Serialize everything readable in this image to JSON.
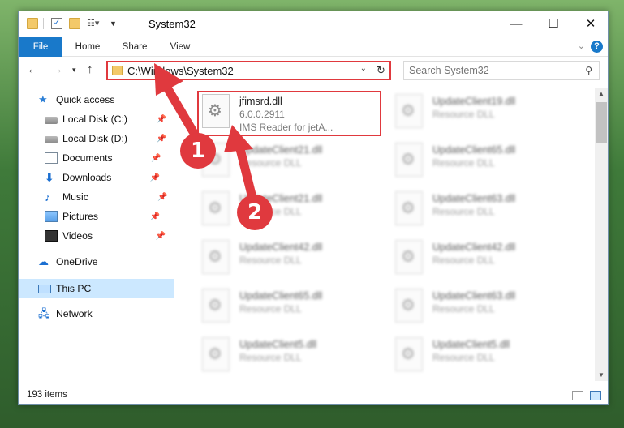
{
  "window": {
    "title": "System32",
    "controls": {
      "minimize": "—",
      "maximize": "☐",
      "close": "✕"
    }
  },
  "ribbon": {
    "tabs": [
      "File",
      "Home",
      "Share",
      "View"
    ],
    "help": "?"
  },
  "address": {
    "path": "C:\\Windows\\System32",
    "search_placeholder": "Search System32"
  },
  "nav_pane": {
    "quick_access": "Quick access",
    "items": [
      {
        "label": "Local Disk (C:)",
        "icon": "drive-icon"
      },
      {
        "label": "Local Disk (D:)",
        "icon": "drive-icon"
      },
      {
        "label": "Documents",
        "icon": "documents-icon"
      },
      {
        "label": "Downloads",
        "icon": "downloads-icon"
      },
      {
        "label": "Music",
        "icon": "music-icon"
      },
      {
        "label": "Pictures",
        "icon": "pictures-icon"
      },
      {
        "label": "Videos",
        "icon": "videos-icon"
      }
    ],
    "onedrive": "OneDrive",
    "this_pc": "This PC",
    "network": "Network"
  },
  "files": {
    "highlighted": {
      "name": "jfimsrd.dll",
      "version": "6.0.0.2911",
      "description": "IMS Reader for jetA..."
    },
    "left_column": [
      {
        "name": "UpdateClient21.dll",
        "description": "Resource DLL"
      },
      {
        "name": "UpdateClient21.dll",
        "description": "Resource DLL"
      },
      {
        "name": "UpdateClient42.dll",
        "description": "Resource DLL"
      },
      {
        "name": "UpdateClient65.dll",
        "description": "Resource DLL"
      },
      {
        "name": "UpdateClient5.dll",
        "description": "Resource DLL"
      }
    ],
    "right_column": [
      {
        "name": "UpdateClient19.dll",
        "description": "Resource DLL"
      },
      {
        "name": "UpdateClient65.dll",
        "description": "Resource DLL"
      },
      {
        "name": "UpdateClient63.dll",
        "description": "Resource DLL"
      },
      {
        "name": "UpdateClient42.dll",
        "description": "Resource DLL"
      },
      {
        "name": "UpdateClient63.dll",
        "description": "Resource DLL"
      },
      {
        "name": "UpdateClient5.dll",
        "description": "Resource DLL"
      }
    ]
  },
  "status": {
    "item_count": "193 items"
  },
  "annotations": {
    "step1": "1",
    "step2": "2",
    "accent": "#e0393e"
  }
}
